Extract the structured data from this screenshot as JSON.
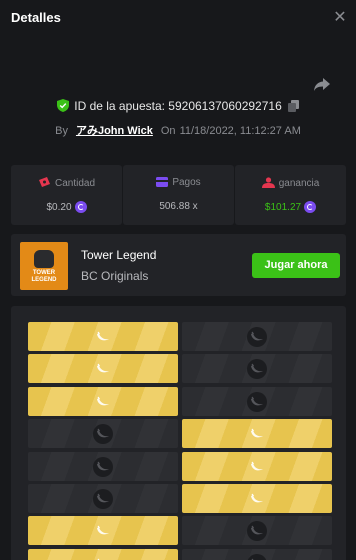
{
  "header": {
    "title": "Detalles",
    "close_glyph": "✕"
  },
  "bet": {
    "id_label": "ID de la apuesta: 59206137060292716",
    "by_label": "By",
    "user": "アみJohn Wick",
    "on_label": "On",
    "date": "11/18/2022, 11:12:27 AM"
  },
  "stats": [
    {
      "label": "Cantidad",
      "value": "$0.20",
      "icon": "bill-icon",
      "color": "#e5364f",
      "coin": true
    },
    {
      "label": "Pagos",
      "value": "506.88 x",
      "icon": "card-icon",
      "color": "#7b4cf0",
      "coin": false
    },
    {
      "label": "ganancia",
      "value": "$101.27",
      "icon": "profit-icon",
      "color": "#e5364f",
      "value_color": "#3bc117",
      "coin": true
    }
  ],
  "game": {
    "thumb_text": "TOWER LEGEND",
    "name": "Tower Legend",
    "provider": "BC Originals",
    "play_label": "Jugar ahora"
  },
  "board": {
    "rows": [
      [
        "gold",
        "dark"
      ],
      [
        "gold",
        "dark"
      ],
      [
        "gold",
        "dark"
      ],
      [
        "dark",
        "gold"
      ],
      [
        "dark",
        "gold"
      ],
      [
        "dark",
        "gold"
      ],
      [
        "gold",
        "dark"
      ],
      [
        "gold",
        "dark"
      ]
    ]
  },
  "colors": {
    "accent_green": "#3bc117",
    "coin_purple": "#7b4cf0",
    "tile_gold": "#e7c44e"
  }
}
